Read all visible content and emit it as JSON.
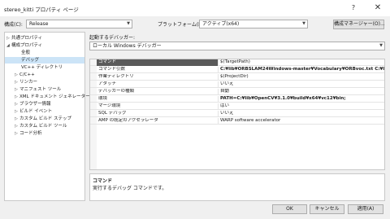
{
  "window": {
    "title": "stereo_kitti プロパティ ページ",
    "help": "?",
    "close": "✕"
  },
  "config": {
    "config_label": "構成(C):",
    "config_value": "Release",
    "platform_label": "プラットフォーム(P):",
    "platform_value": "アクティブ(x64)",
    "manager_button": "構成マネージャー(O)..."
  },
  "tree": {
    "items": [
      {
        "label": "共通プロパティ",
        "toggle": "▷"
      },
      {
        "label": "構成プロパティ",
        "toggle": "◢"
      },
      {
        "label": "全般",
        "toggle": ""
      },
      {
        "label": "デバッグ",
        "toggle": ""
      },
      {
        "label": "VC++ ディレクトリ",
        "toggle": ""
      },
      {
        "label": "C/C++",
        "toggle": "▷"
      },
      {
        "label": "リンカー",
        "toggle": "▷"
      },
      {
        "label": "マニフェスト ツール",
        "toggle": "▷"
      },
      {
        "label": "XML ドキュメント ジェネレーター",
        "toggle": "▷"
      },
      {
        "label": "ブラウザー情報",
        "toggle": "▷"
      },
      {
        "label": "ビルド イベント",
        "toggle": "▷"
      },
      {
        "label": "カスタム ビルド ステップ",
        "toggle": "▷"
      },
      {
        "label": "カスタム ビルド ツール",
        "toggle": "▷"
      },
      {
        "label": "コード分析",
        "toggle": "▷"
      }
    ]
  },
  "debugger": {
    "label": "起動するデバッガー:",
    "value": "ローカル Windows デバッガー"
  },
  "properties": [
    {
      "name": "コマンド",
      "value": "$(TargetPath)"
    },
    {
      "name": "コマンド引数",
      "value": "C:¥lib¥ORBSLAM24Windows-master¥Vocabulary¥ORBvoc.txt C:¥lib¥ORB"
    },
    {
      "name": "作業ディレクトリ",
      "value": "$(ProjectDir)"
    },
    {
      "name": "アタッチ",
      "value": "いいえ"
    },
    {
      "name": "デバッガーの種類",
      "value": "自動"
    },
    {
      "name": "環境",
      "value": "PATH=C:¥lib¥OpenCV¥3.1.0¥build¥x64¥vc12¥bin;"
    },
    {
      "name": "マージ環境",
      "value": "はい"
    },
    {
      "name": "SQL デバッグ",
      "value": "いいえ"
    },
    {
      "name": "AMP の既定のアクセラレータ",
      "value": "WARP software accelerator"
    }
  ],
  "description": {
    "title": "コマンド",
    "text": "実行するデバッグ コマンドです。"
  },
  "buttons": {
    "ok": "OK",
    "cancel": "キャンセル",
    "apply": "適用(A)"
  }
}
